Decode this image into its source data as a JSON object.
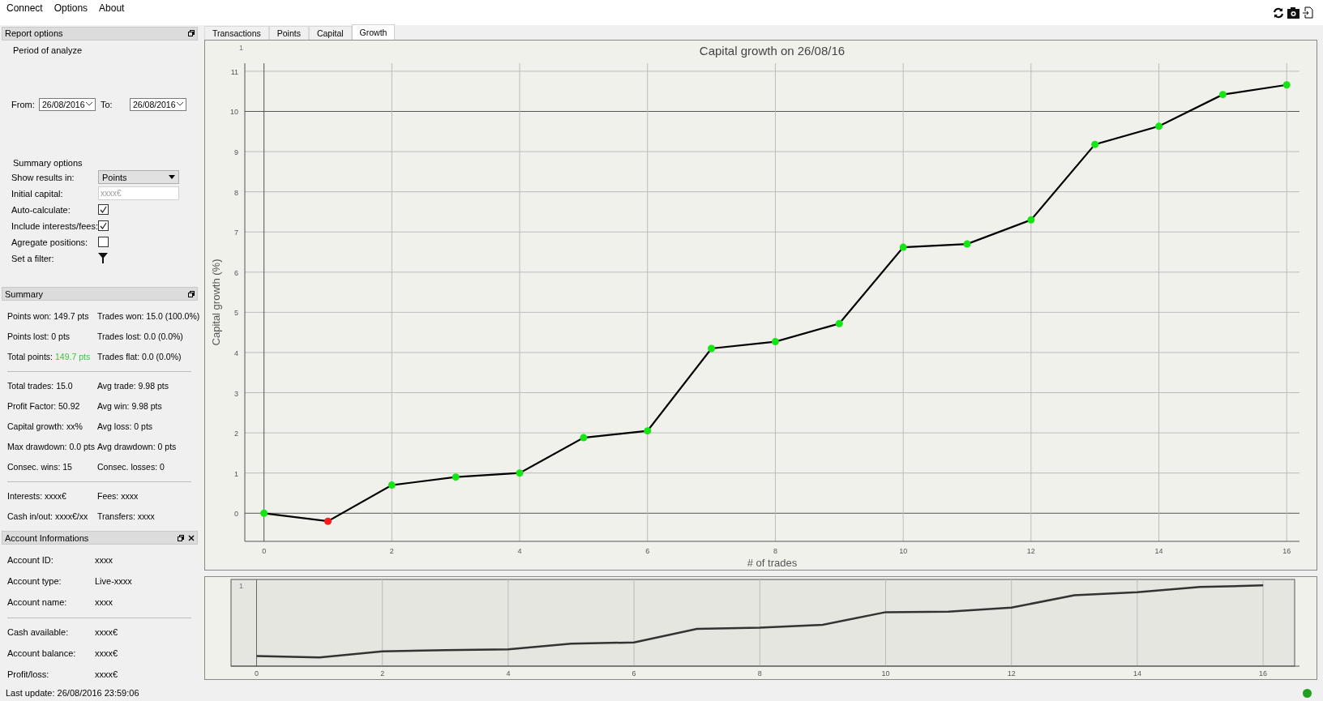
{
  "menu": [
    "Connect",
    "Options",
    "About"
  ],
  "toolbar": [
    {
      "kind": "refresh"
    },
    {
      "kind": "camera"
    },
    {
      "kind": "export"
    }
  ],
  "report_options": {
    "title": "Report options",
    "period_label": "Period of analyze",
    "from_label": "From:",
    "from_value": "26/08/2016",
    "to_label": "To:",
    "to_value": "26/08/2016",
    "summary_options_label": "Summary options",
    "rows": [
      {
        "kind": "select",
        "label": "Show results in:",
        "value": "Points"
      },
      {
        "kind": "input",
        "label": "Initial capital:",
        "placeholder": "xxxx€"
      },
      {
        "kind": "checkbox",
        "label": "Auto-calculate:",
        "checked": true
      },
      {
        "kind": "checkbox",
        "label": "Include interests/fees:",
        "checked": true
      },
      {
        "kind": "checkbox",
        "label": "Agregate positions:",
        "checked": false
      },
      {
        "kind": "filter",
        "label": "Set a filter:"
      }
    ]
  },
  "summary": {
    "title": "Summary",
    "groups": [
      [
        [
          {
            "label": "Points won:",
            "value": "149.7 pts",
            "positive": false
          },
          {
            "label": "Trades won:",
            "value": "15.0 (100.0%)",
            "positive": false
          }
        ],
        [
          {
            "label": "Points lost:",
            "value": "0 pts",
            "positive": false
          },
          {
            "label": "Trades lost:",
            "value": "0.0 (0.0%)",
            "positive": false
          }
        ],
        [
          {
            "label": "Total points:",
            "value": "149.7 pts",
            "positive": true
          },
          {
            "label": "Trades flat:",
            "value": "0.0 (0.0%)",
            "positive": false
          }
        ]
      ],
      [
        [
          {
            "label": "Total trades:",
            "value": "15.0",
            "positive": false
          },
          {
            "label": "Avg trade:",
            "value": "9.98 pts",
            "positive": false
          }
        ],
        [
          {
            "label": "Profit Factor:",
            "value": "50.92",
            "positive": false
          },
          {
            "label": "Avg win:",
            "value": "9.98 pts",
            "positive": false
          }
        ],
        [
          {
            "label": "Capital growth:",
            "value": "xx%",
            "positive": false
          },
          {
            "label": "Avg loss:",
            "value": "0 pts",
            "positive": false
          }
        ],
        [
          {
            "label": "Max drawdown:",
            "value": "0.0 pts",
            "positive": false
          },
          {
            "label": "Avg drawdown:",
            "value": "0 pts",
            "positive": false
          }
        ],
        [
          {
            "label": "Consec. wins:",
            "value": "15",
            "positive": false
          },
          {
            "label": "Consec. losses:",
            "value": "0",
            "positive": false
          }
        ]
      ],
      [
        [
          {
            "label": "Interests:",
            "value": "xxxx€",
            "positive": false
          },
          {
            "label": "Fees:",
            "value": "xxxx",
            "positive": false
          }
        ],
        [
          {
            "label": "Cash in/out:",
            "value": "xxxx€/xx",
            "positive": false
          },
          {
            "label": "Transfers:",
            "value": "xxxx",
            "positive": false
          }
        ]
      ]
    ]
  },
  "account": {
    "title": "Account Informations",
    "groups": [
      [
        {
          "label": "Account ID:",
          "value": "xxxx"
        },
        {
          "label": "Account type:",
          "value": "Live-xxxx"
        },
        {
          "label": "Account name:",
          "value": "xxxx"
        }
      ],
      [
        {
          "label": "Cash available:",
          "value": "xxxx€"
        },
        {
          "label": "Account balance:",
          "value": "xxxx€"
        },
        {
          "label": "Profit/loss:",
          "value": "xxxx€"
        }
      ]
    ]
  },
  "tabs": [
    {
      "label": "Transactions",
      "selected": false
    },
    {
      "label": "Points",
      "selected": false
    },
    {
      "label": "Capital",
      "selected": false
    },
    {
      "label": "Growth",
      "selected": true
    }
  ],
  "growth_chart": {
    "corner_label": "1",
    "chart_data": {
      "type": "line",
      "title": "Capital growth on 26/08/16",
      "xlabel": "# of trades",
      "ylabel": "Capital growth (%)",
      "x": [
        0,
        1,
        2,
        3,
        4,
        5,
        6,
        7,
        8,
        9,
        10,
        11,
        12,
        13,
        14,
        15,
        16
      ],
      "grid": true,
      "series": [
        {
          "color": "#000000",
          "marker": "circle",
          "values": [
            0,
            -0.2,
            0.7,
            0.9,
            1.0,
            1.88,
            2.05,
            4.1,
            4.27,
            4.72,
            6.62,
            6.7,
            7.3,
            9.18,
            9.63,
            10.42,
            10.66
          ]
        }
      ],
      "xlim": [
        -0.3,
        16.2
      ],
      "ylim": [
        -0.7,
        11.2
      ],
      "xticks": [
        0,
        2,
        4,
        6,
        8,
        10,
        12,
        14,
        16
      ],
      "yticks": [
        0,
        1,
        2,
        3,
        4,
        5,
        6,
        7,
        8,
        9,
        10,
        11
      ]
    }
  },
  "overview": {
    "corner_label": "1",
    "x_labels": [
      "0",
      "2",
      "4",
      "6",
      "8",
      "10",
      "12",
      "14",
      "16"
    ]
  },
  "status_bar": {
    "text": "Last update: 26/08/2016 23:59:06",
    "connected": true
  }
}
